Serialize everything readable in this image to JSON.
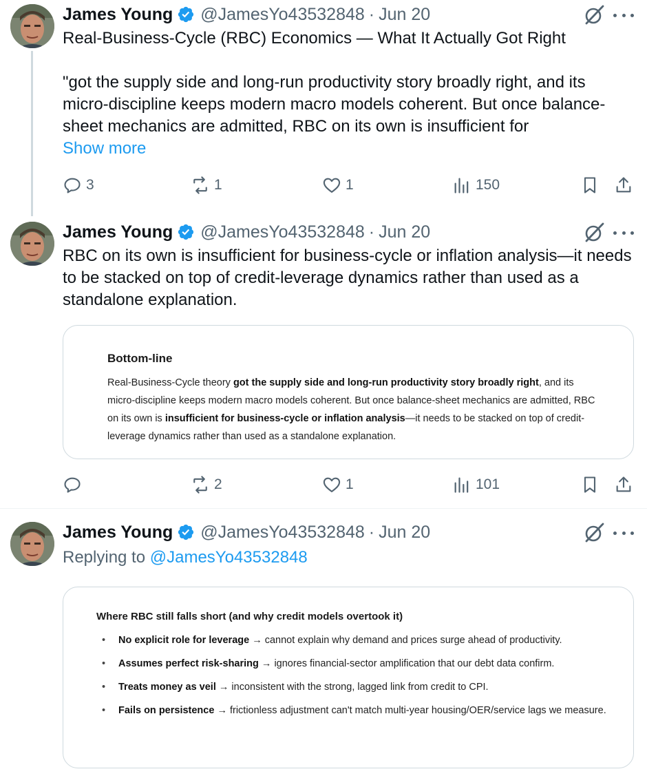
{
  "colors": {
    "accent": "#1d9bf0",
    "secondary_text": "#536471",
    "border": "#cfd9de"
  },
  "tweets": [
    {
      "author": {
        "name": "James Young",
        "handle": "@JamesYo43532848",
        "date": "Jun 20",
        "verified_icon": "verified-badge-icon"
      },
      "text_lines": [
        "Real-Business-Cycle (RBC) Economics — What It Actually Got Right",
        "\"got the supply side and long-run productivity story broadly right, and its micro-discipline keeps modern macro models coherent. But once balance-sheet mechanics are admitted, RBC on its own is insufficient for"
      ],
      "show_more": "Show more",
      "stats": {
        "replies": "3",
        "reposts": "1",
        "likes": "1",
        "views": "150"
      }
    },
    {
      "author": {
        "name": "James Young",
        "handle": "@JamesYo43532848",
        "date": "Jun 20"
      },
      "text": "RBC on its own is insufficient for business-cycle or inflation analysis—it needs to be stacked on top of credit-leverage dynamics rather than used as a standalone explanation.",
      "card": {
        "title": "Bottom-line",
        "segments": [
          {
            "t": "Real-Business-Cycle theory ",
            "bold": false
          },
          {
            "t": "got the supply side and long-run productivity story broadly right",
            "bold": true
          },
          {
            "t": ", and its micro-discipline keeps modern macro models coherent. But once balance-sheet mechanics are admitted, RBC on its own is ",
            "bold": false
          },
          {
            "t": "insufficient for business-cycle or inflation analysis",
            "bold": true
          },
          {
            "t": "—it needs to be stacked on top of credit-leverage dynamics rather than used as a standalone explanation.",
            "bold": false
          }
        ]
      },
      "stats": {
        "replies": "",
        "reposts": "2",
        "likes": "1",
        "views": "101"
      }
    },
    {
      "author": {
        "name": "James Young",
        "handle": "@JamesYo43532848",
        "date": "Jun 20"
      },
      "replying_to_label": "Replying to",
      "replying_to_handle": "@JamesYo43532848",
      "card": {
        "title": "Where RBC still falls short (and why credit models overtook it)",
        "bullets": [
          {
            "bold": "No explicit role for leverage",
            "rest": " → cannot explain why demand and prices surge ahead of productivity."
          },
          {
            "bold": "Assumes perfect risk-sharing",
            "rest": " → ignores financial-sector amplification that our debt data confirm."
          },
          {
            "bold": "Treats money as veil",
            "rest": " → inconsistent with the strong, lagged link from credit to CPI."
          },
          {
            "bold": "Fails on persistence",
            "rest": " → frictionless adjustment can't match multi-year housing/OER/service lags we measure."
          }
        ]
      }
    }
  ]
}
